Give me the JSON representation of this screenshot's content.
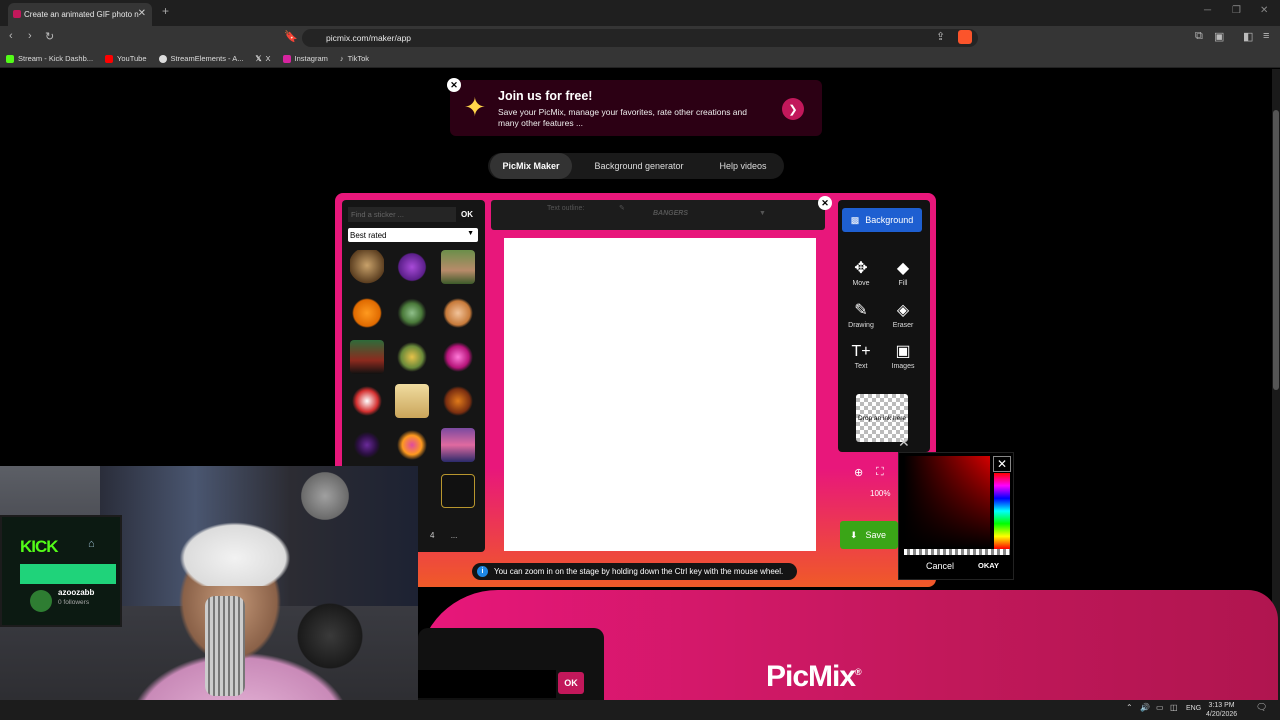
{
  "browser": {
    "tab_title": "Create an animated GIF photo n",
    "url": "picmix.com/maker/app",
    "bookmarks": [
      "Stream - Kick Dashb...",
      "YouTube",
      "StreamElements - A...",
      "X",
      "Instagram",
      "TikTok"
    ]
  },
  "banner": {
    "title": "Join us for free!",
    "text": "Save your PicMix, manage your favorites, rate other creations and many other features ..."
  },
  "nav_tabs": [
    "PicMix Maker",
    "Background generator",
    "Help videos"
  ],
  "stickers": {
    "search_placeholder": "Find a sticker ...",
    "search_ok": "OK",
    "sort": "Best rated",
    "page": "4",
    "more": "..."
  },
  "text_toolbar": {
    "outline_label": "Text outline:",
    "font": "BANGERS"
  },
  "tools": {
    "background": "Background",
    "items": [
      "Move",
      "Fill",
      "Drawing",
      "Eraser",
      "Text",
      "Images"
    ],
    "drop": "Drop an ink here",
    "zoom": "100%",
    "save": "Save"
  },
  "color_picker": {
    "cancel": "Cancel",
    "okay": "OKAY"
  },
  "info": "You can zoom in on the stage by holding down the Ctrl key with the mouse wheel.",
  "footer": {
    "ok": "OK",
    "logo": "PicMix"
  },
  "webcam": {
    "kick_logo": "KICK",
    "username": "azoozabb",
    "followers": "0 followers"
  },
  "taskbar": {
    "lang": "ENG",
    "time": "3:13 PM",
    "date": "4/20/2026"
  },
  "colors": {
    "accent": "#e8177b",
    "bg_button": "#1e5fd1",
    "save": "#3aa517",
    "kick_green": "#53fc18"
  }
}
